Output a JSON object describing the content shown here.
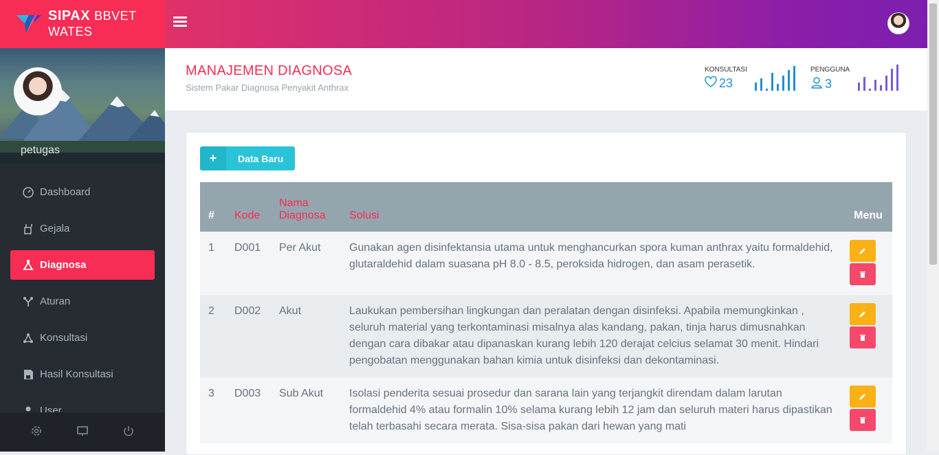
{
  "brand": {
    "name_bold": "SIPAX",
    "name_rest": "BBVET WATES"
  },
  "sidebar": {
    "username": "petugas",
    "items": [
      {
        "label": "Dashboard",
        "icon": "dashboard-icon",
        "active": false
      },
      {
        "label": "Gejala",
        "icon": "gejala-icon",
        "active": false
      },
      {
        "label": "Diagnosa",
        "icon": "flask-icon",
        "active": true
      },
      {
        "label": "Aturan",
        "icon": "rules-icon",
        "active": false
      },
      {
        "label": "Konsultasi",
        "icon": "network-icon",
        "active": false
      },
      {
        "label": "Hasil Konsultasi",
        "icon": "save-icon",
        "active": false
      },
      {
        "label": "User",
        "icon": "user-icon",
        "active": false
      }
    ],
    "footer_icons": [
      "gear-icon",
      "monitor-icon",
      "power-icon"
    ]
  },
  "header": {
    "title": "MANAJEMEN DIAGNOSA",
    "subtitle": "Sistem Pakar Diagnosa Penyakit Anthrax",
    "stats": [
      {
        "label": "KONSULTASI",
        "value": "23",
        "icon": "heart-icon",
        "color": "#1f8fd6"
      },
      {
        "label": "PENGGUNA",
        "value": "3",
        "icon": "user-icon",
        "color": "#7a5ad6"
      }
    ]
  },
  "main": {
    "new_button_label": "Data Baru",
    "table": {
      "headers": {
        "no": "#",
        "kode": "Kode",
        "nama": "Nama Diagnosa",
        "solusi": "Solusi",
        "menu": "Menu"
      },
      "rows": [
        {
          "no": "1",
          "kode": "D001",
          "nama": "Per Akut",
          "solusi": "Gunakan agen disinfektansia utama untuk menghancurkan spora kuman anthrax yaitu formaldehid, glutaraldehid dalam suasana pH 8.0 - 8.5, peroksida hidrogen, dan asam perasetik."
        },
        {
          "no": "2",
          "kode": "D002",
          "nama": "Akut",
          "solusi": "Laukukan pembersihan lingkungan dan peralatan dengan disinfeksi. Apabila memungkinkan , seluruh material yang terkontaminasi misalnya alas kandang, pakan, tinja harus dimusnahkan dengan cara dibakar atau dipanaskan kurang lebih 120 derajat celcius selamat 30 menit. Hindari pengobatan menggunakan bahan kimia untuk disinfeksi dan dekontaminasi."
        },
        {
          "no": "3",
          "kode": "D003",
          "nama": "Sub Akut",
          "solusi": "Isolasi penderita sesuai prosedur dan sarana lain yang terjangkit direndam dalam larutan formaldehid 4% atau formalin 10% selama kurang lebih 12 jam dan seluruh materi harus dipastikan telah terbasahi secara merata. Sisa-sisa pakan dari hewan yang mati"
        }
      ]
    }
  },
  "colors": {
    "accent": "#f72d55",
    "cyan": "#2ac4d8",
    "edit": "#f9b115",
    "delete": "#f5486a"
  }
}
